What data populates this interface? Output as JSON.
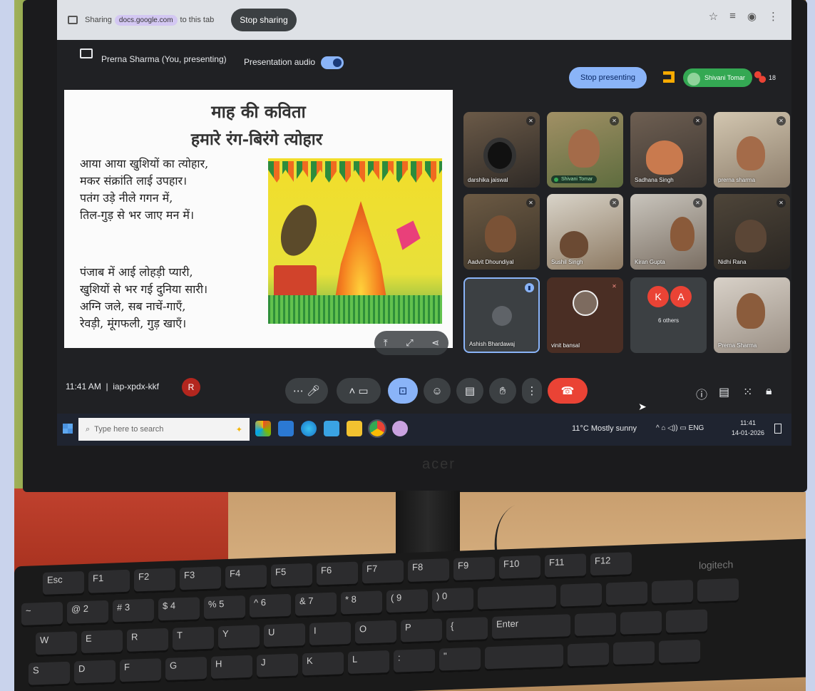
{
  "share_bar": {
    "prefix": "Sharing",
    "domain": "docs.google.com",
    "suffix": "to this tab",
    "stop_sharing": "Stop sharing"
  },
  "meet_header": {
    "presenter": "Prerna Sharma (You, presenting)",
    "audio_label": "Presentation audio",
    "audio_on": true,
    "stop_presenting": "Stop presenting",
    "active_speaker": "Shivani Tomar",
    "participant_count": "18"
  },
  "slide": {
    "title_line1": "माह की कविता",
    "title_line2": "हमारे रंग-बिरंगे त्योहार",
    "stanza1": [
      "आया आया खुशियों का त्योहार,",
      "मकर संक्रांति लाई उपहार।",
      "पतंग उड़े नीले गगन में,",
      "तिल-गुड़ से भर जाए मन में।"
    ],
    "stanza2": [
      "पंजाब में आई लोहड़ी प्यारी,",
      "खुशियों से भर गई दुनिया सारी।",
      "अग्नि जले, सब नाचें-गाएँ,",
      "रेवड़ी, मूंगफली, गुड़ खाएँ।"
    ]
  },
  "participants": [
    {
      "name": "darshika jaiswal"
    },
    {
      "name": "Shivani Tomar"
    },
    {
      "name": "Sadhana Singh"
    },
    {
      "name": "prerna sharma"
    },
    {
      "name": "Aadvit Dhoundiyal"
    },
    {
      "name": "Sushil Singh"
    },
    {
      "name": "Kiran Gupta"
    },
    {
      "name": "Nidhi Rana"
    },
    {
      "name": "Ashish Bhardawaj"
    },
    {
      "name": "vinit bansal"
    },
    {
      "name": "6 others",
      "letters": [
        "K",
        "A"
      ]
    },
    {
      "name": "Prerna Sharma"
    }
  ],
  "bottom_bar": {
    "time": "11:41 AM",
    "meeting_code": "iap-xpdx-kkf",
    "code_badge": "R"
  },
  "taskbar": {
    "search_placeholder": "Type here to search",
    "weather": "11°C  Mostly sunny",
    "lang": "ENG",
    "clock_time": "11:41",
    "clock_date": "14-01-2026"
  },
  "monitor": {
    "brand": "acer"
  },
  "keyboard": {
    "brand": "logitech"
  },
  "colors": {
    "meet_bg": "#202124",
    "accent_blue": "#8ab4f8",
    "end_call_red": "#ea4335",
    "speaker_green": "#34a853"
  }
}
